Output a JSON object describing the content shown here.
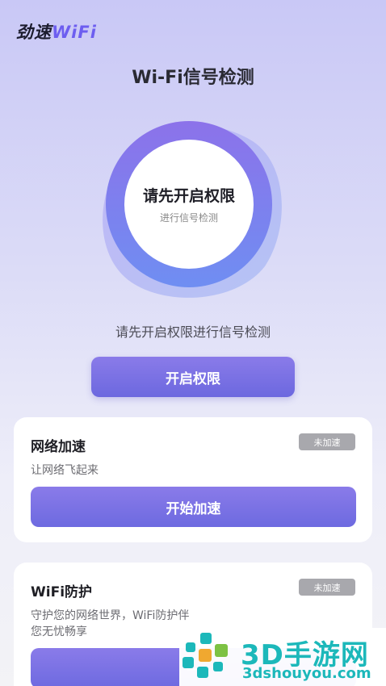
{
  "app": {
    "logo_cn": "劲速",
    "logo_en": "WiFi",
    "page_title": "Wi-Fi信号检测"
  },
  "gauge": {
    "main_text": "请先开启权限",
    "sub_text": "进行信号检测"
  },
  "hint_text": "请先开启权限进行信号检测",
  "permission_button": "开启权限",
  "cards": [
    {
      "title": "网络加速",
      "badge": "未加速",
      "desc": "让网络飞起来",
      "button": "开始加速"
    },
    {
      "title": "WiFi防护",
      "badge": "未加速",
      "desc": "守护您的网络世界，WiFi防护伴您无忧畅享",
      "button": "一"
    }
  ],
  "watermark": {
    "brand": "3D手游网",
    "url": "3dshouyou.com"
  },
  "colors": {
    "accent": "#6d5ef0",
    "button_gradient_top": "#8a7be9",
    "button_gradient_bottom": "#6c68df",
    "badge": "#a8a8ad",
    "watermark": "#1cb8ba"
  }
}
